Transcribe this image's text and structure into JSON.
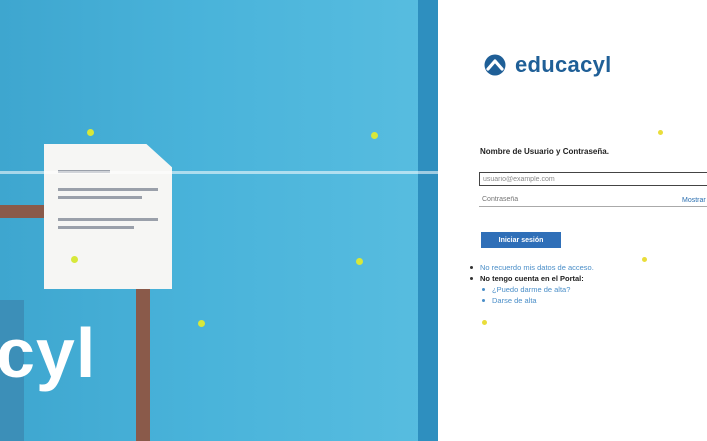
{
  "hero": {
    "brand_text": "cyl"
  },
  "logo": {
    "icon": "educacyl-chevron-logo-icon",
    "text": "educacyl"
  },
  "login": {
    "title": "Nombre de Usuario y Contraseña.",
    "username_value": "usuario@example.com",
    "password_placeholder": "Contraseña",
    "show_label": "Mostrar",
    "submit_label": "Iniciar sesión"
  },
  "help_links": {
    "forgot": "No recuerdo mis datos de acceso.",
    "no_account": "No tengo cuenta en el Portal:",
    "can_register": "¿Puedo darme de alta?",
    "register": "Darse de alta"
  },
  "colors": {
    "brand_blue": "#1f5f97",
    "button_blue": "#2f6fb8",
    "hero_blue": "#49b3da",
    "link_blue": "#4a8ec8"
  }
}
